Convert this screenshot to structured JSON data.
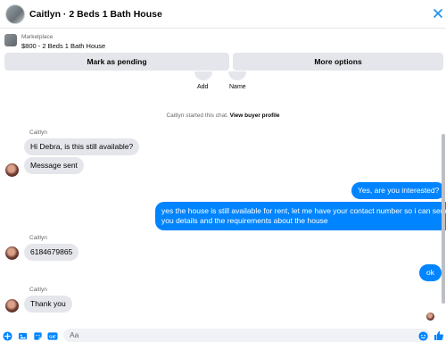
{
  "header": {
    "title": "Caitlyn · 2 Beds 1 Bath House",
    "close_icon": "close-icon"
  },
  "listing": {
    "source": "Marketplace",
    "price_line": "$800 - 2 Beds 1 Bath House"
  },
  "actions": {
    "pending_label": "Mark as pending",
    "more_label": "More options"
  },
  "quick_actions": [
    {
      "label": "Add"
    },
    {
      "label": "Name"
    }
  ],
  "system_note": {
    "text": "Caitlyn started this chat.",
    "link": "View buyer profile"
  },
  "messages": [
    {
      "sender": "Caitlyn",
      "text": "Hi Debra, is this still available?"
    },
    {
      "text": "Message sent"
    },
    {
      "text": "Yes, are you interested?"
    },
    {
      "text_line1": "yes the house is still available for rent, let me have your contact number so i can send",
      "text_line2": "you details and the requirements about the house"
    },
    {
      "sender": "Caitlyn",
      "text": "6184679865"
    },
    {
      "text": "ok"
    },
    {
      "sender": "Caitlyn",
      "text": "Thank you"
    }
  ],
  "composer": {
    "placeholder": "Aa",
    "icons": [
      "plus-circle-icon",
      "image-icon",
      "sticker-icon",
      "gif-icon",
      "emoji-icon",
      "like-icon"
    ]
  },
  "colors": {
    "accent": "#0084ff",
    "incoming_bubble": "#e4e6eb",
    "secondary_text": "#65676b"
  }
}
